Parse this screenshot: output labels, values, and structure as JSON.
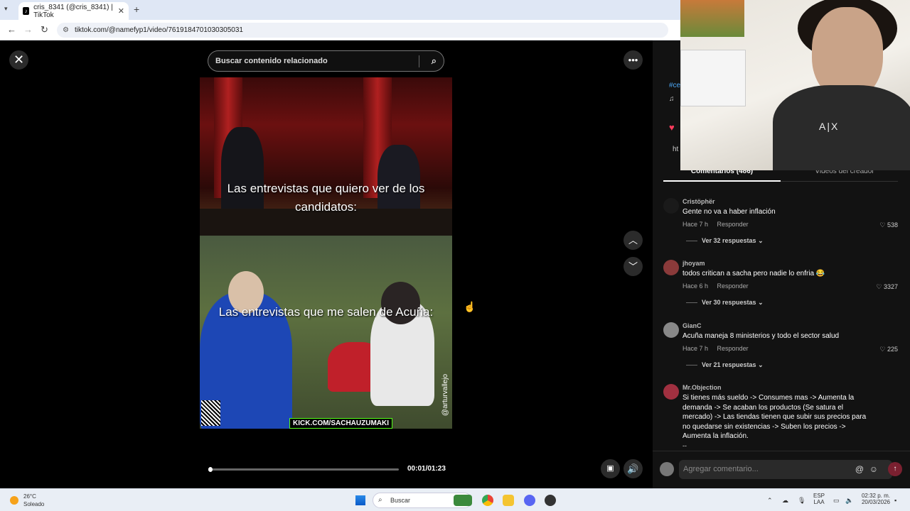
{
  "browser": {
    "tab_title": "cris_8341 (@cris_8341) | TikTok",
    "tab_close": "✕",
    "new_tab": "+",
    "url": "tiktok.com/@namefyp1/video/7619184701030305031"
  },
  "player": {
    "search_placeholder": "Buscar contenido relacionado",
    "caption_top": "Las entrevistas que quiero ver de los candidatos:",
    "caption_bottom": "Las entrevistas que me salen de Acuña:",
    "kick_text": "KICK.COM/SACHAUZUMAKI",
    "watermark": "@arturvallejo",
    "time": "00:01/01:23",
    "progress": 0.01
  },
  "panel": {
    "hashtag_snip": "#ce",
    "music_snip": "♫",
    "link_snip": "ht",
    "tab_comments": "Comentarios (486)",
    "tab_videos": "Videos del creador",
    "comments": [
      {
        "user": "Cristöphër",
        "text": "Gente no va a haber inflación",
        "time": "Hace 7 h",
        "reply": "Responder",
        "likes": "538",
        "replies": "Ver 32 respuestas",
        "avatar_color": "#1a1a1a"
      },
      {
        "user": "jhoyam",
        "text": "todos critican a sacha pero nadie lo enfria 😂",
        "time": "Hace 6 h",
        "reply": "Responder",
        "likes": "3327",
        "replies": "Ver 30 respuestas",
        "avatar_color": "#8a3a3a"
      },
      {
        "user": "GianC",
        "text": "Acuña maneja 8 ministerios y todo el sector salud",
        "time": "Hace 7 h",
        "reply": "Responder",
        "likes": "225",
        "replies": "Ver 21 respuestas",
        "avatar_color": "#888888"
      },
      {
        "user": "Mr.Objection",
        "text": "Si tienes más sueldo -> Consumes mas -> Aumenta la demanda -> Se acaban los productos (Se satura el mercado) -> Las tiendas tienen que subir sus precios para no quedarse sin existencias -> Suben los precios -> Aumenta la inflación.",
        "extra": "--",
        "avatar_color": "#a03040"
      }
    ],
    "add_comment_placeholder": "Agregar comentario..."
  },
  "taskbar": {
    "temp": "26°C",
    "condition": "Soleado",
    "search": "Buscar",
    "lang1": "ESP",
    "lang2": "LAA",
    "time": "02:32 p. m.",
    "date": "20/03/2026"
  },
  "webcam": {
    "shirt_logo": "A|X"
  }
}
